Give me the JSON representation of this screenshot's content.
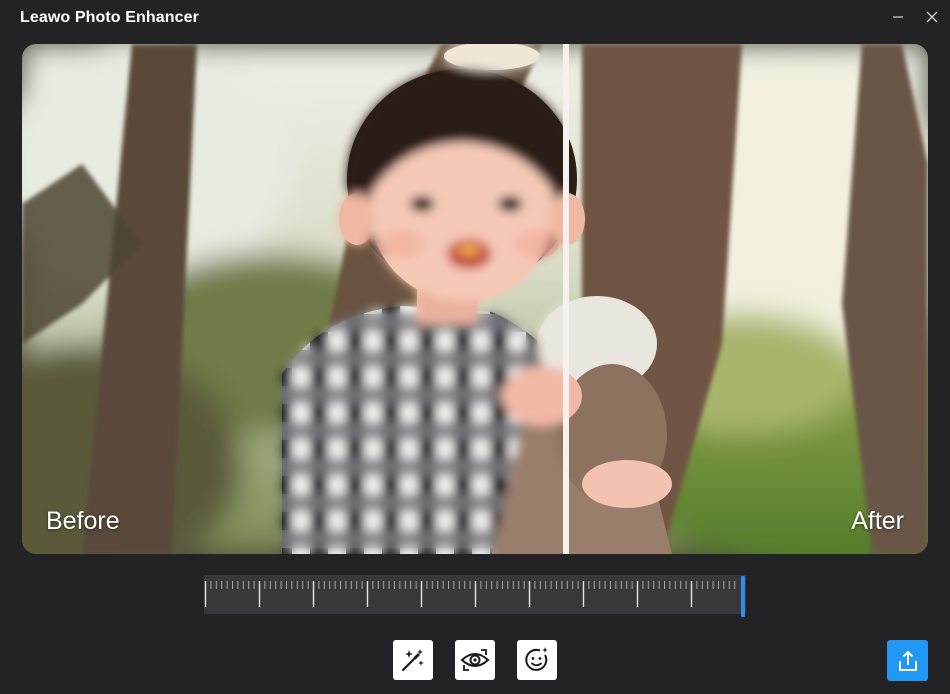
{
  "window": {
    "title": "Leawo Photo Enhancer"
  },
  "titlebar": {
    "minimize_icon": "minimize-icon",
    "close_icon": "close-icon"
  },
  "preview": {
    "before_label": "Before",
    "after_label": "After",
    "split_position": 0.6
  },
  "ruler": {
    "position": 1.0
  },
  "toolbar": {
    "tools": [
      {
        "icon": "magic-wand-icon"
      },
      {
        "icon": "eye-icon"
      },
      {
        "icon": "face-icon"
      }
    ],
    "export_icon": "share-export-icon"
  },
  "colors": {
    "background": "#232326",
    "accent": "#2196f3",
    "ruler_handle": "#2f8ef5",
    "ruler_track": "#38383c"
  }
}
